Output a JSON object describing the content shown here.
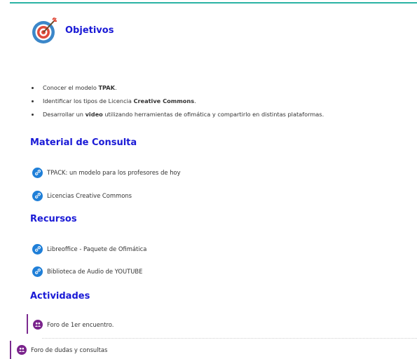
{
  "objectives": {
    "title": "Objetivos",
    "items": [
      {
        "pre": "Conocer el modelo ",
        "bold": "TPAK",
        "post": "."
      },
      {
        "pre": "Identificar los tipos de Licencia ",
        "bold": "Creative Commons",
        "post": "."
      },
      {
        "pre": "Desarrollar un ",
        "bold": "video",
        "post": " utilizando herramientas de ofimática y compartirlo en distintas plataformas."
      }
    ]
  },
  "material": {
    "title": "Material de Consulta",
    "links": [
      {
        "label": "TPACK: un modelo para los profesores de hoy",
        "icon": "link-icon"
      },
      {
        "label": "Licencias Creative Commons",
        "icon": "link-icon"
      }
    ]
  },
  "resources": {
    "title": "Recursos",
    "links": [
      {
        "label": "Libreoffice - Paquete de Ofimática",
        "icon": "link-icon"
      },
      {
        "label": "Biblioteca de Audio de YOUTUBE",
        "icon": "link-icon"
      }
    ]
  },
  "activities": {
    "title": "Actividades",
    "items": [
      {
        "label": "Foro de 1er encuentro.",
        "icon": "forum-icon"
      },
      {
        "label": "Foro de dudas y consultas",
        "icon": "forum-icon"
      }
    ]
  },
  "colors": {
    "heading": "#1a1ad6",
    "accent_line": "#2bb3a4",
    "link_icon": "#1f7fd8",
    "forum_icon": "#7a238c",
    "activity_bar": "#7b2b8f"
  }
}
